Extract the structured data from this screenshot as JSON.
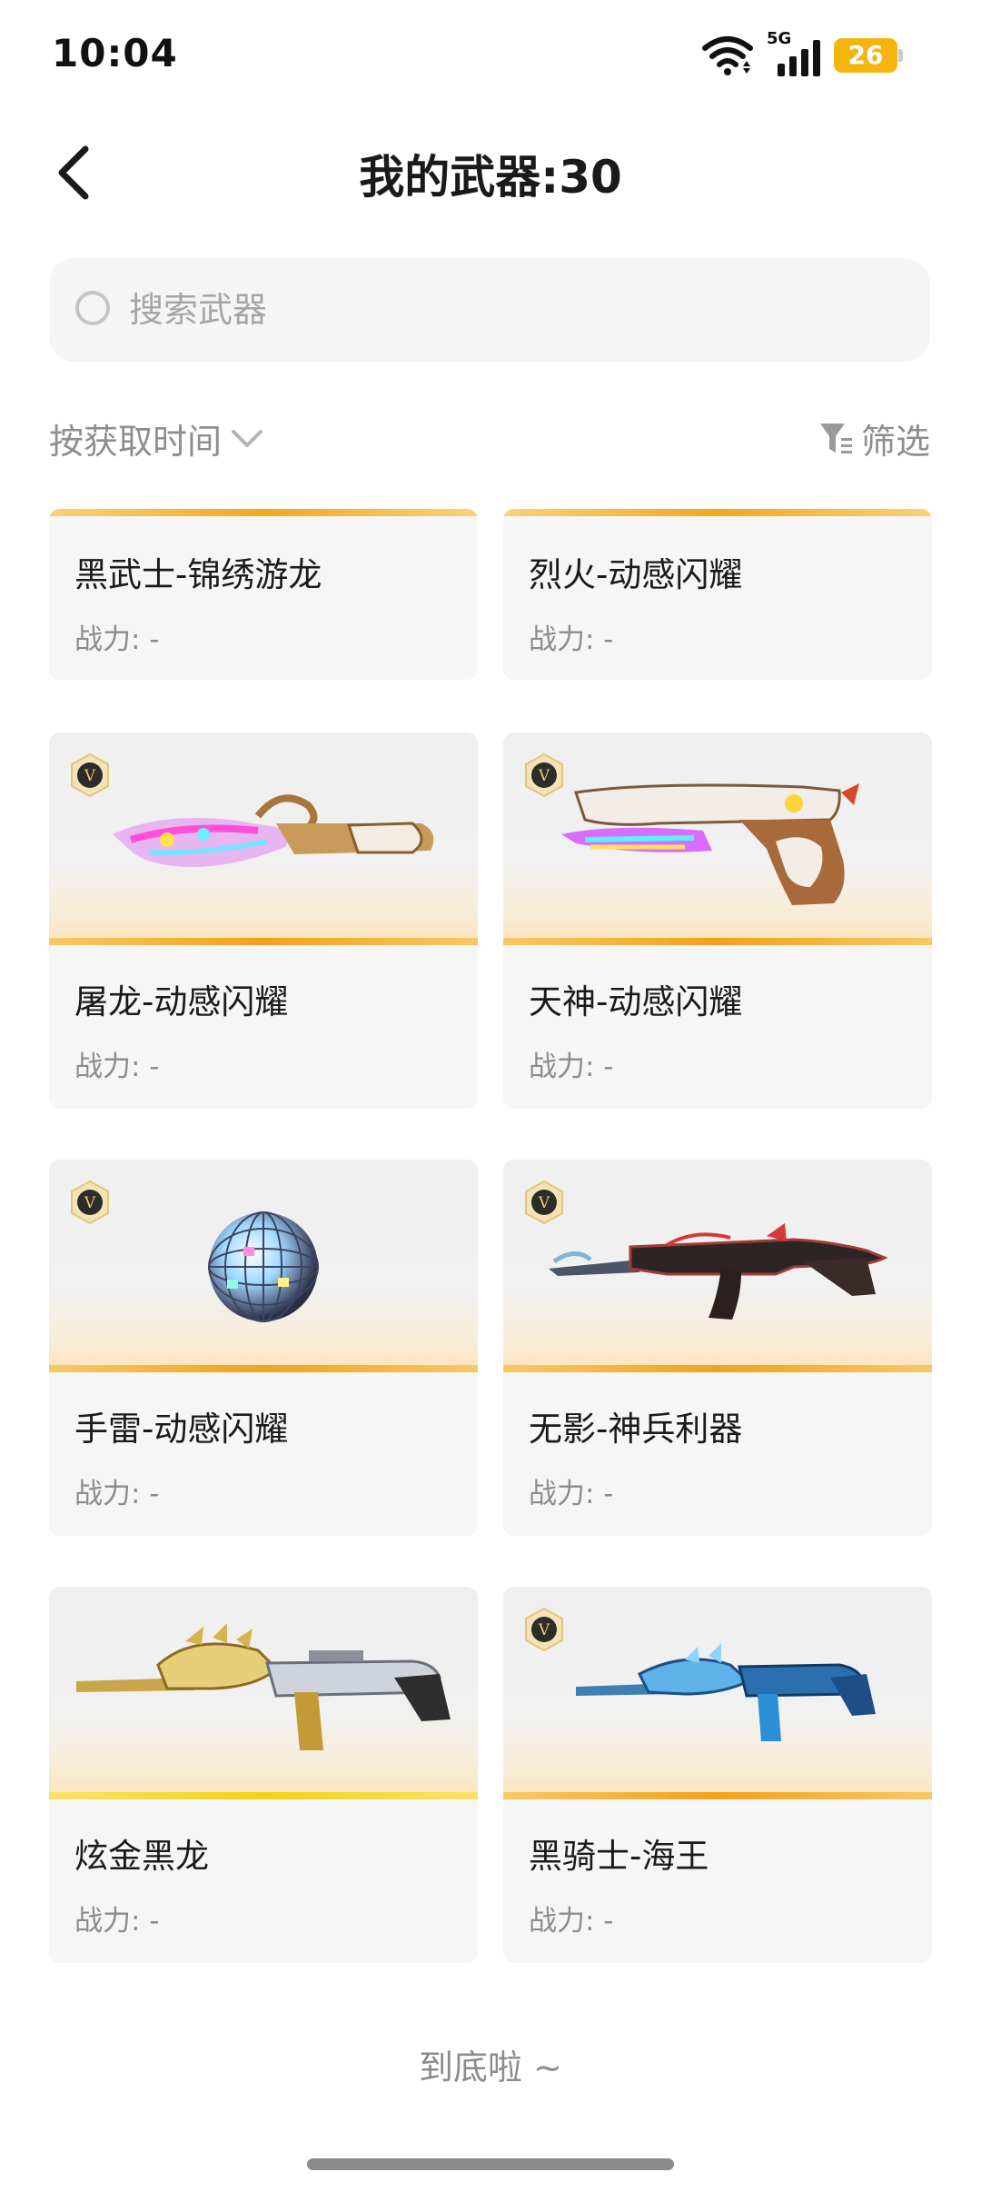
{
  "status_bar": {
    "time": "10:04",
    "network_label": "5G",
    "battery_level": "26",
    "battery_color": "#f6b50e"
  },
  "header": {
    "title": "我的武器:30",
    "back_icon": "chevron-left-icon"
  },
  "search": {
    "placeholder": "搜索武器",
    "value": ""
  },
  "toolbar": {
    "sort_label": "按获取时间",
    "filter_label": "筛选"
  },
  "weapons": [
    {
      "name": "黑武士-锦绣游龙",
      "power": "战力: -",
      "vip": false,
      "has_image": false
    },
    {
      "name": "烈火-动感闪耀",
      "power": "战力: -",
      "vip": false,
      "has_image": false
    },
    {
      "name": "屠龙-动感闪耀",
      "power": "战力: -",
      "vip": true,
      "has_image": true,
      "icon": "knife-icon"
    },
    {
      "name": "天神-动感闪耀",
      "power": "战力: -",
      "vip": true,
      "has_image": true,
      "icon": "pistol-icon"
    },
    {
      "name": "手雷-动感闪耀",
      "power": "战力: -",
      "vip": true,
      "has_image": true,
      "icon": "disco-grenade-icon"
    },
    {
      "name": "无影-神兵利器",
      "power": "战力: -",
      "vip": true,
      "has_image": true,
      "icon": "rifle-icon"
    },
    {
      "name": "炫金黑龙",
      "power": "战力: -",
      "vip": false,
      "has_image": true,
      "icon": "gold-rifle-icon"
    },
    {
      "name": "黑骑士-海王",
      "power": "战力: -",
      "vip": true,
      "has_image": true,
      "icon": "blue-rifle-icon"
    }
  ],
  "vip_badge_letter": "V",
  "footer": {
    "end_text": "到底啦 ~"
  },
  "colors": {
    "accent": "#f3a81d",
    "card_bg": "#f6f6f6",
    "muted_text": "#8c8c8c"
  }
}
